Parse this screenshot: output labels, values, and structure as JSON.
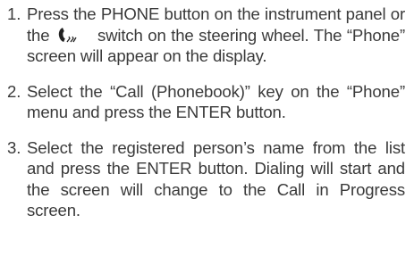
{
  "steps": [
    {
      "number": "1.",
      "text_before_icon": "Press the PHONE button on the instrument panel or the ",
      "icon": "phone-handset-icon",
      "text_after_icon": "switch on the steering wheel. The “Phone” screen will appear on the display."
    },
    {
      "number": "2.",
      "text": "Select the “Call (Phonebook)” key on the “Phone” menu and press the ENTER button."
    },
    {
      "number": "3.",
      "text": "Select the registered person’s name from the list and press the ENTER button. Dialing will start and the screen will change to the Call in Progress screen."
    }
  ]
}
